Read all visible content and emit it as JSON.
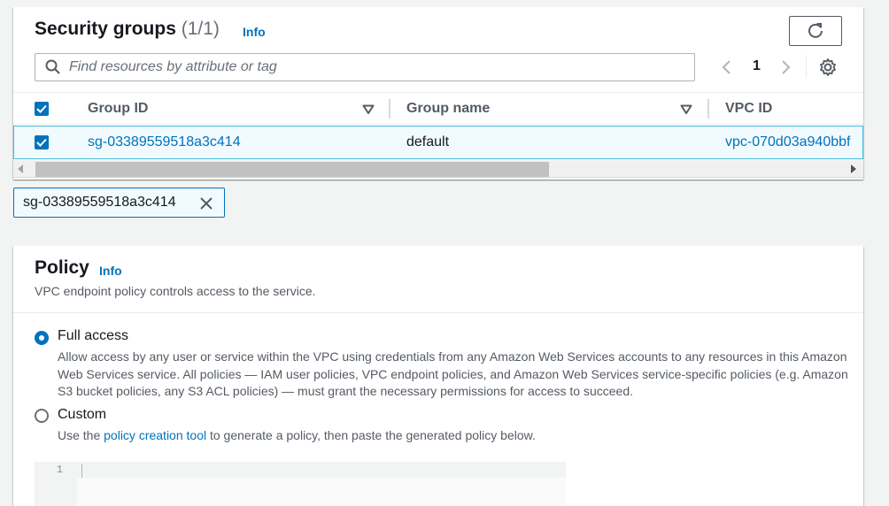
{
  "security_groups": {
    "title": "Security groups",
    "count": "(1/1)",
    "info": "Info",
    "search_placeholder": "Find resources by attribute or tag",
    "page": "1",
    "columns": [
      "Group ID",
      "Group name",
      "VPC ID"
    ],
    "rows": [
      {
        "group_id": "sg-03389559518a3c414",
        "group_name": "default",
        "vpc_id": "vpc-070d03a940bbf"
      }
    ],
    "selected_token": "sg-03389559518a3c414"
  },
  "policy": {
    "title": "Policy",
    "info": "Info",
    "description": "VPC endpoint policy controls access to the service.",
    "options": [
      {
        "label": "Full access",
        "selected": true,
        "description": "Allow access by any user or service within the VPC using credentials from any Amazon Web Services accounts to any resources in this Amazon Web Services service. All policies — IAM user policies, VPC endpoint policies, and Amazon Web Services service-specific policies (e.g. Amazon S3 bucket policies, any S3 ACL policies) — must grant the necessary permissions for access to succeed."
      },
      {
        "label": "Custom",
        "selected": false,
        "description_prefix": "Use the ",
        "description_link": "policy creation tool",
        "description_suffix": " to generate a policy, then paste the generated policy below."
      }
    ],
    "editor_line": "1"
  },
  "colors": {
    "accent": "#0073bb",
    "selected_row_bg": "#f1faff",
    "selected_row_border": "#44b9d6"
  },
  "icons": [
    "refresh-icon",
    "search-icon",
    "chevron-left-icon",
    "chevron-right-icon",
    "gear-icon",
    "sort-down-icon",
    "checkbox-checked-icon",
    "close-icon"
  ]
}
